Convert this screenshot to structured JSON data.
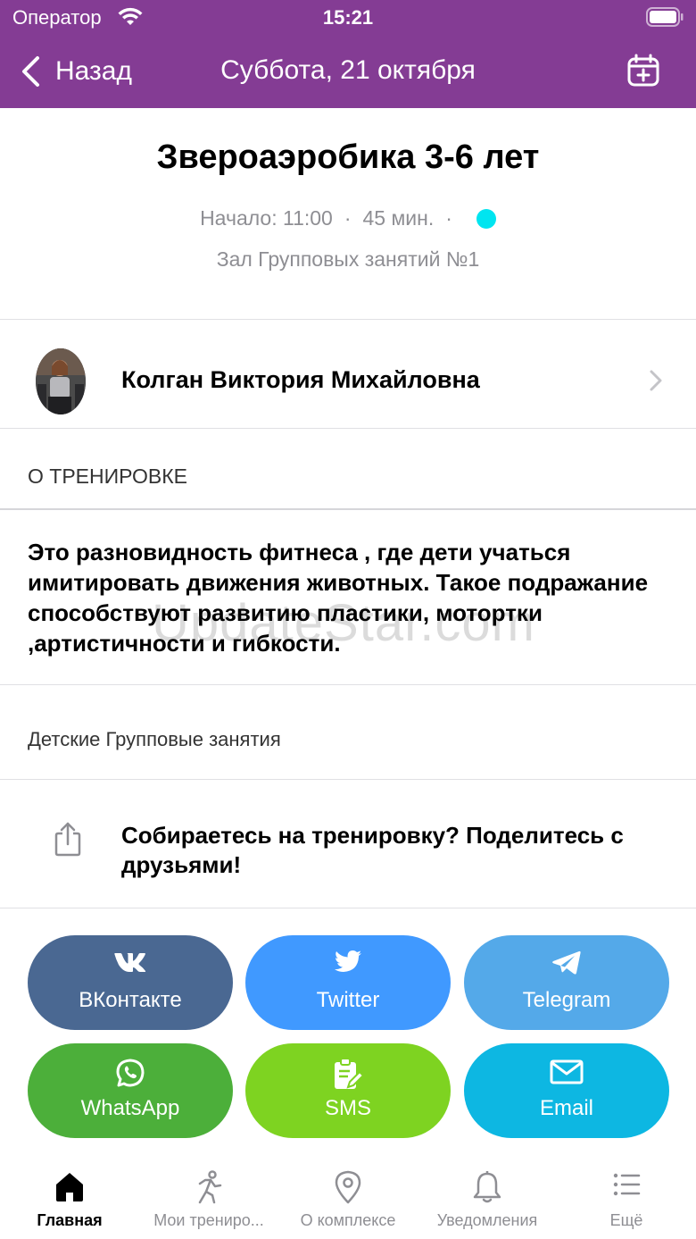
{
  "status_bar": {
    "carrier": "Оператор",
    "time": "15:21"
  },
  "nav": {
    "back_label": "Назад",
    "title": "Суббота, 21 октября"
  },
  "class": {
    "title": "Звероаэробика 3-6 лет",
    "start": "Начало: 11:00",
    "separator": "·",
    "duration": "45 мин.",
    "status_color": "#00e5f0",
    "hall": "Зал Групповых занятий №1"
  },
  "trainer": {
    "name": "Колган Виктория Михайловна"
  },
  "about": {
    "heading": "О ТРЕНИРОВКЕ",
    "description": "Это разновидность фитнеса , где дети учаться имитировать движения животных. Такое подражание способствуют развитию пластики, мотортки ,артистичности и гибкости.",
    "category": "Детские Групповые занятия"
  },
  "share": {
    "prompt": "Собираетесь на тренировку? Поделитесь с друзьями!",
    "buttons": [
      {
        "label": "ВКонтакте",
        "icon": "vk-icon",
        "color": "#4a6892"
      },
      {
        "label": "Twitter",
        "icon": "twitter-icon",
        "color": "#4099ff"
      },
      {
        "label": "Telegram",
        "icon": "telegram-icon",
        "color": "#54a9e9"
      },
      {
        "label": "WhatsApp",
        "icon": "whatsapp-icon",
        "color": "#4caf3a"
      },
      {
        "label": "SMS",
        "icon": "sms-icon",
        "color": "#7ed321"
      },
      {
        "label": "Email",
        "icon": "email-icon",
        "color": "#0db7e2"
      }
    ]
  },
  "tabs": [
    {
      "label": "Главная",
      "icon": "home-icon",
      "active": true
    },
    {
      "label": "Мои трениро...",
      "icon": "runner-icon",
      "active": false
    },
    {
      "label": "О комплексе",
      "icon": "location-pin-icon",
      "active": false
    },
    {
      "label": "Уведомления",
      "icon": "bell-icon",
      "active": false
    },
    {
      "label": "Ещё",
      "icon": "list-icon",
      "active": false
    }
  ],
  "watermark": "UpdateStar.com",
  "colors": {
    "header": "#843c94",
    "secondary_text": "#8e8e93"
  }
}
